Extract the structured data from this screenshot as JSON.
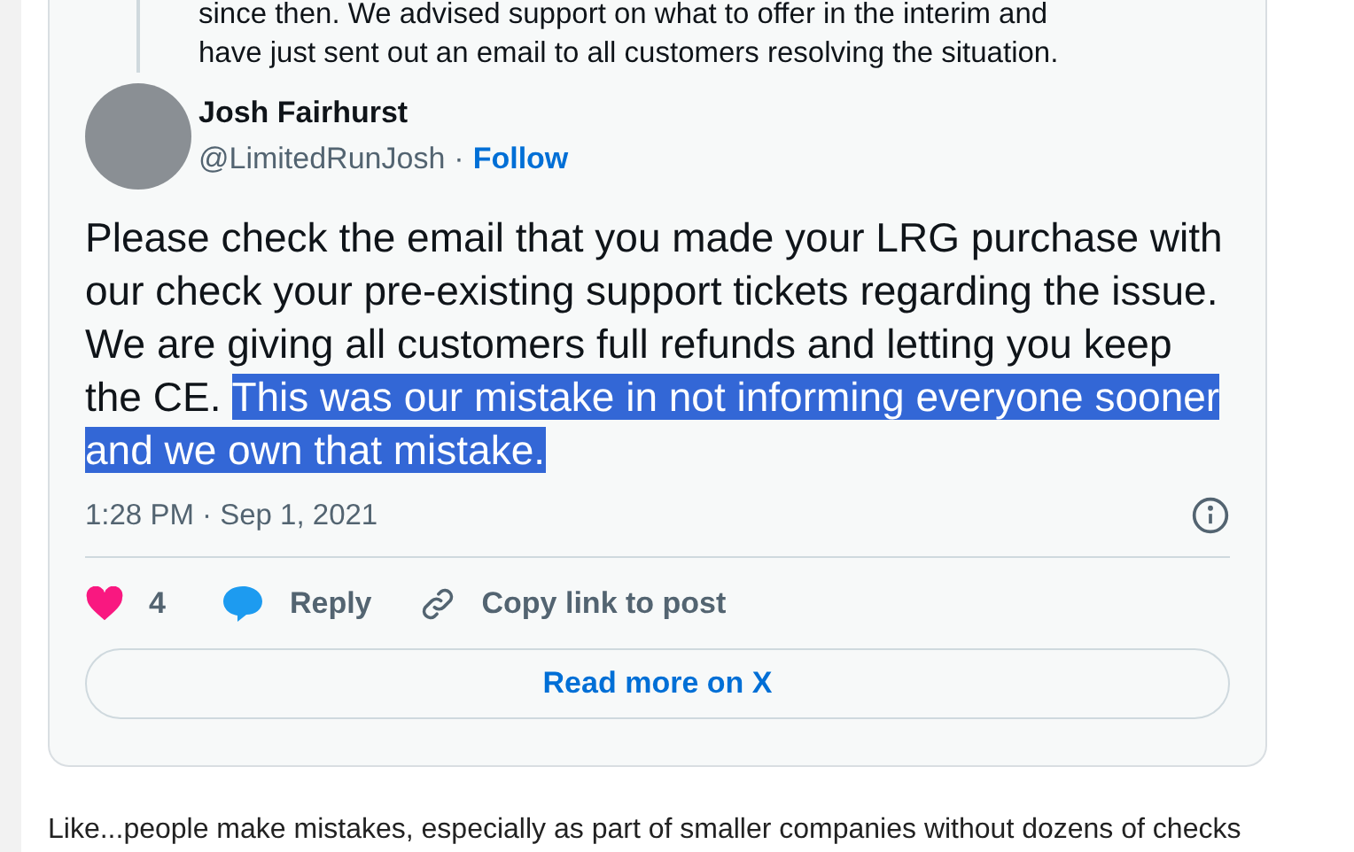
{
  "quoted_post": {
    "lines": [
      "since then. We advised support on what to offer in the interim and",
      "have just sent out an email to all customers resolving the situation."
    ]
  },
  "post": {
    "author": "Josh Fairhurst",
    "handle": "@LimitedRunJosh",
    "separator": "·",
    "follow": "Follow",
    "text": "Please check the email that you made your LRG purchase with our check your pre-existing support tickets regarding the issue. We are giving all customers full refunds and letting you keep the CE. ",
    "selected_text": "This was our mistake in not informing everyone sooner and we own that mistake.",
    "timestamp": "1:28 PM · Sep 1, 2021"
  },
  "actions": {
    "likes": "4",
    "reply": "Reply",
    "copy_link": "Copy link to post",
    "read_more": "Read more on X"
  },
  "article_text": "Like...people make mistakes, especially as part of smaller companies without dozens of checks"
}
